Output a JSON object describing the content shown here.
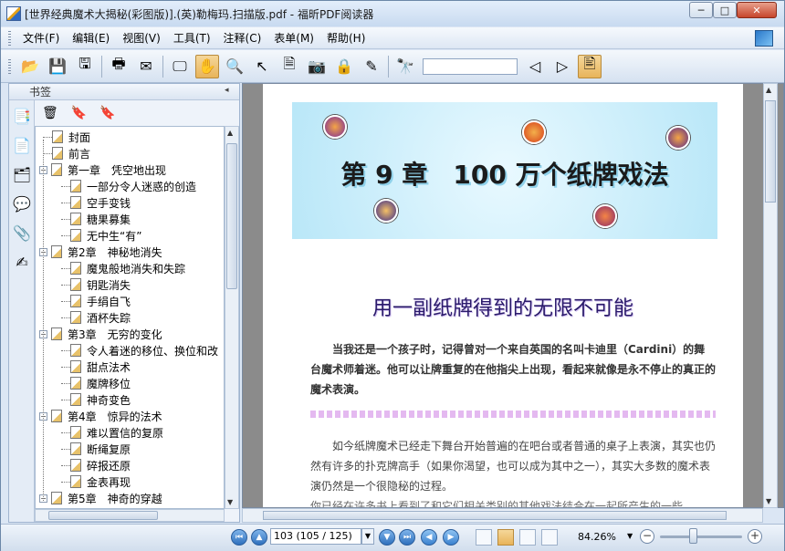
{
  "window": {
    "title": "[世界经典魔术大揭秘(彩图版)].(英)勒梅玛.扫描版.pdf - 福昕PDF阅读器",
    "min_label": "─",
    "max_label": "□",
    "close_label": "✕"
  },
  "menu": [
    "文件(F)",
    "编辑(E)",
    "视图(V)",
    "工具(T)",
    "注释(C)",
    "表单(M)",
    "帮助(H)"
  ],
  "toolbar": {
    "icons": [
      "open-folder-icon",
      "save-icon",
      "save-as-icon",
      "print-icon",
      "email-icon",
      "fullscreen-icon",
      "hand-tool-icon",
      "zoom-tool-icon",
      "select-tool-icon",
      "text-select-icon",
      "snapshot-icon",
      "rms-icon",
      "sign-icon",
      "find-icon",
      "prev-result-icon",
      "next-result-icon",
      "typewriter-icon"
    ],
    "search_value": ""
  },
  "sidebar": {
    "title": "书签",
    "bookmarks": [
      {
        "label": "封面",
        "level": 1
      },
      {
        "label": "前言",
        "level": 1
      },
      {
        "label": "第一章　凭空地出现",
        "level": 0
      },
      {
        "label": "一部分令人迷惑的创造",
        "level": 2
      },
      {
        "label": "空手变钱",
        "level": 2
      },
      {
        "label": "糖果募集",
        "level": 2
      },
      {
        "label": "无中生“有”",
        "level": 2
      },
      {
        "label": "第2章　神秘地消失",
        "level": 0
      },
      {
        "label": "魔鬼般地消失和失踪",
        "level": 2
      },
      {
        "label": "钥匙消失",
        "level": 2
      },
      {
        "label": "手绢自飞",
        "level": 2
      },
      {
        "label": "酒杯失踪",
        "level": 2
      },
      {
        "label": "第3章　无穷的变化",
        "level": 0
      },
      {
        "label": "令人着迷的移位、换位和改",
        "level": 2
      },
      {
        "label": "甜点法术",
        "level": 2
      },
      {
        "label": "魔牌移位",
        "level": 2
      },
      {
        "label": "神奇变色",
        "level": 2
      },
      {
        "label": "第4章　惊异的法术",
        "level": 0
      },
      {
        "label": "难以置信的复原",
        "level": 2
      },
      {
        "label": "断绳复原",
        "level": 2
      },
      {
        "label": "碎报还原",
        "level": 2
      },
      {
        "label": "金表再现",
        "level": 2
      },
      {
        "label": "第5章　神奇的穿越",
        "level": 0
      }
    ]
  },
  "document": {
    "chapter_title": "第 9 章　100 万个纸牌戏法",
    "subtitle": "用一副纸牌得到的无限不可能",
    "intro": "当我还是一个孩子时，记得曾对一个来自英国的名叫卡迪里（Cardini）的舞台魔术师着迷。他可以让牌重复的在他指尖上出现，看起来就像是永不停止的真正的魔术表演。",
    "body": "如今纸牌魔术已经走下舞台开始普遍的在吧台或者普通的桌子上表演，其实也仍然有许多的扑克牌高手（如果你渴望，也可以成为其中之一），其实大多数的魔术表演仍然是一个很隐秘的过程。",
    "body_cut": "你已经在许多书上看到了和它们相关类别的其他戏法结合在一起所产生的一些"
  },
  "status": {
    "page_value": "103 (105 / 125)",
    "zoom": "84.26%",
    "zoom_out_label": "−",
    "zoom_in_label": "+"
  },
  "colors": {
    "title_bar": "#c8daf0",
    "page_bg": "#8b8b8b",
    "subtitle": "#2a1a6a",
    "accent_active": "#e8b45a"
  }
}
